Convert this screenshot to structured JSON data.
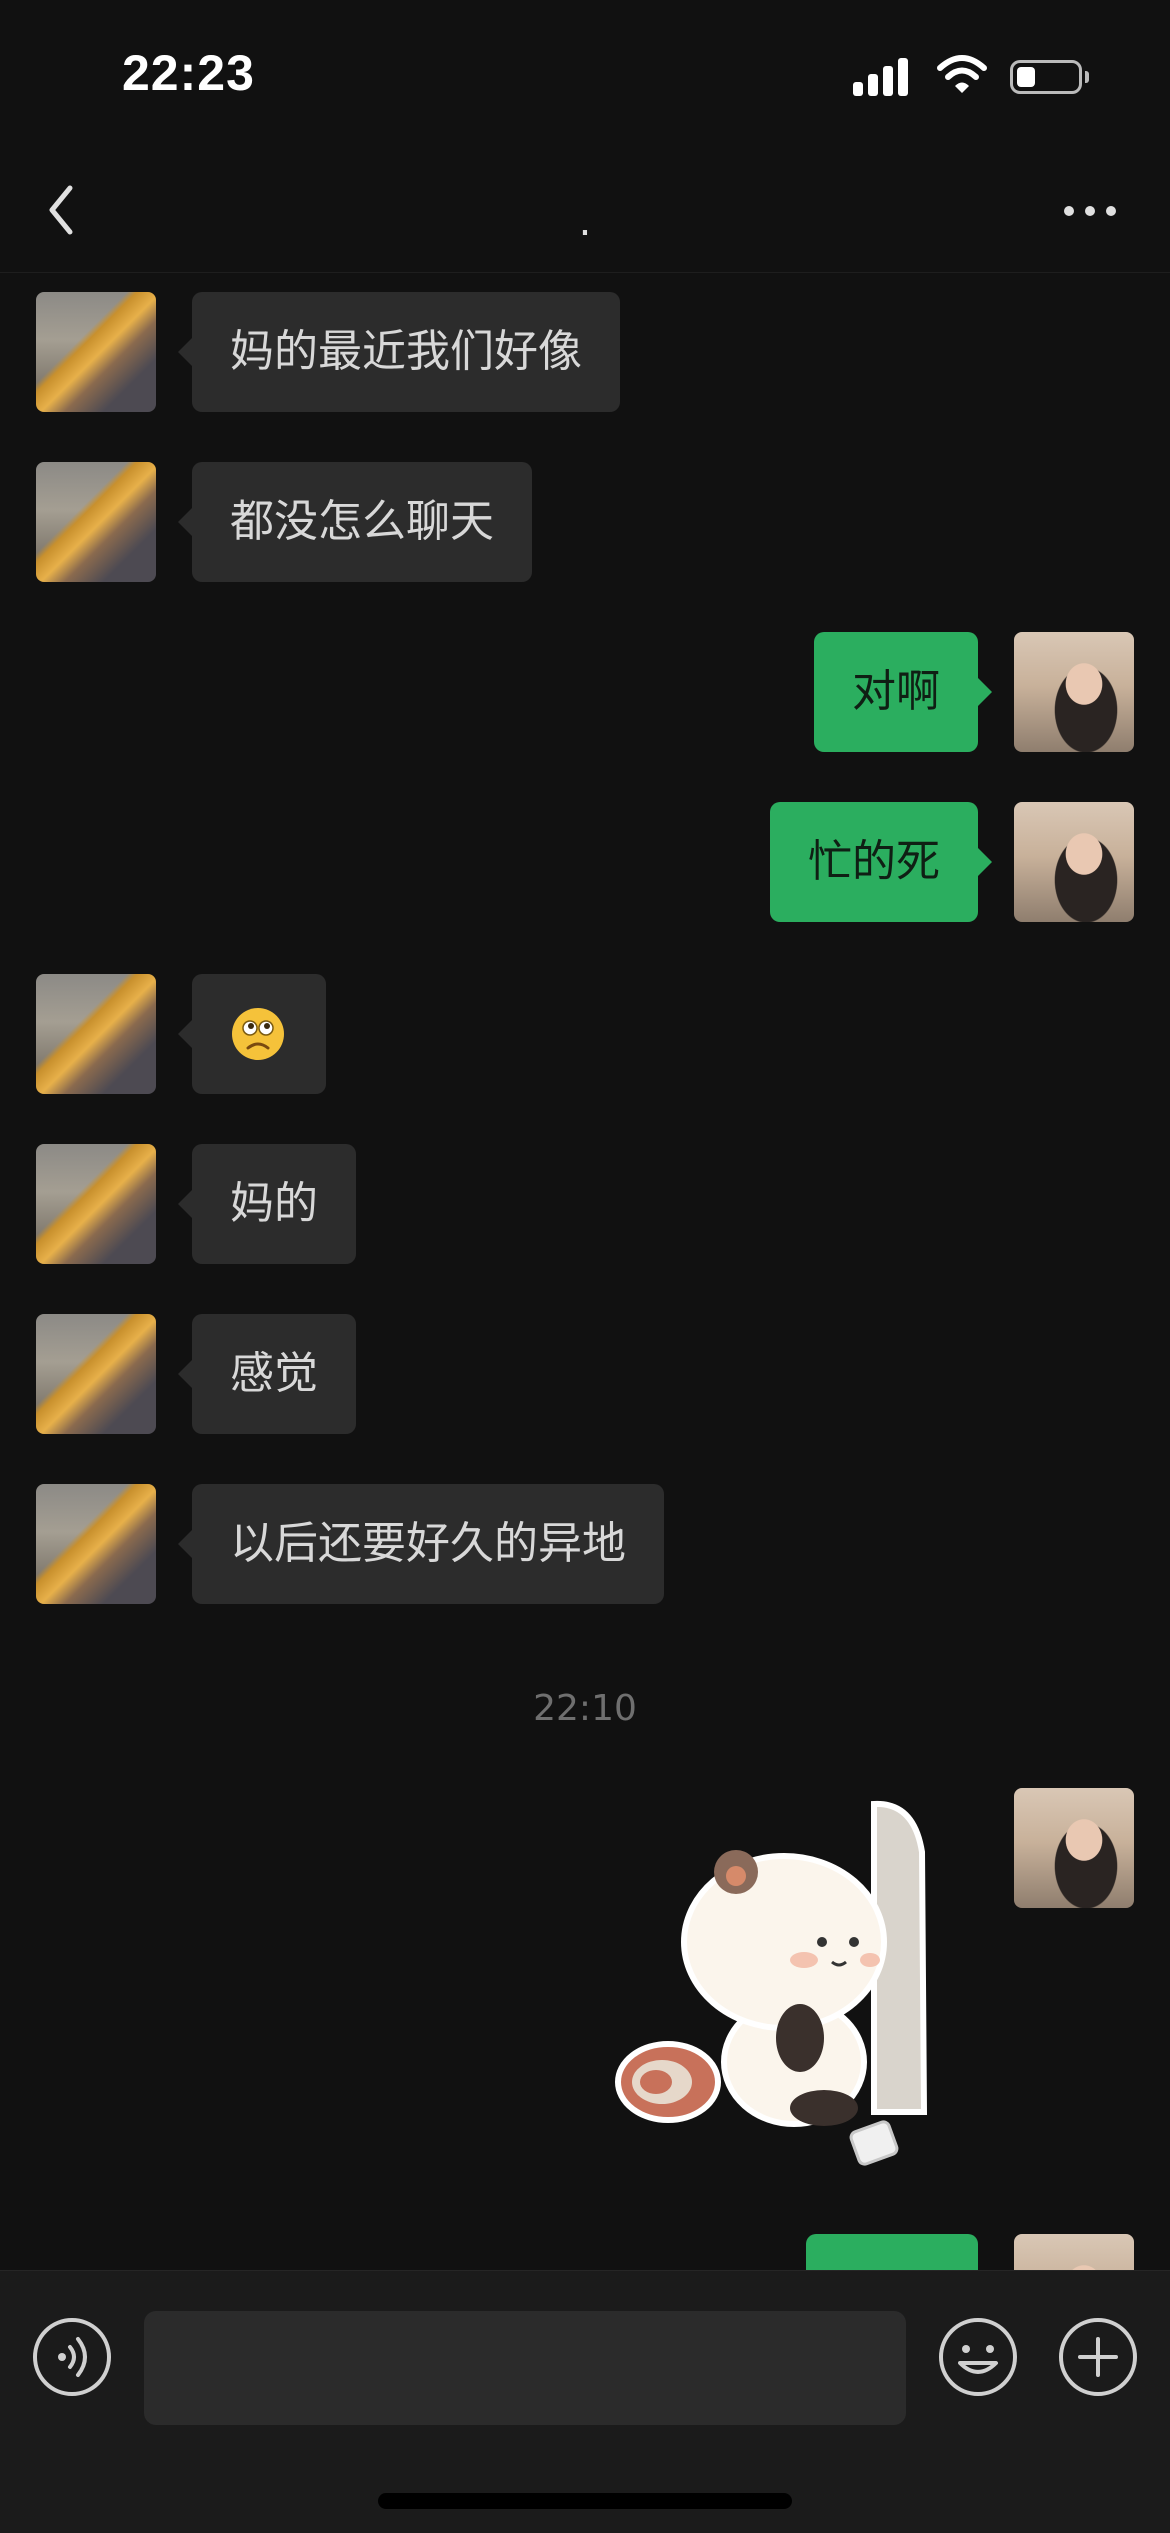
{
  "status_bar": {
    "time": "22:23",
    "battery_level": 0.3
  },
  "nav": {
    "title": "."
  },
  "messages": [
    {
      "side": "in",
      "type": "text",
      "text": "妈的最近我们好像"
    },
    {
      "side": "in",
      "type": "text",
      "text": "都没怎么聊天"
    },
    {
      "side": "out",
      "type": "text",
      "text": "对啊"
    },
    {
      "side": "out",
      "type": "text",
      "text": "忙的死"
    },
    {
      "side": "in",
      "type": "emoji",
      "emoji": "sad-face-icon"
    },
    {
      "side": "in",
      "type": "text",
      "text": "妈的"
    },
    {
      "side": "in",
      "type": "text",
      "text": "感觉"
    },
    {
      "side": "in",
      "type": "text",
      "text": "以后还要好久的异地"
    },
    {
      "type": "timestamp",
      "text": "22:10"
    },
    {
      "side": "out",
      "type": "sticker",
      "sticker": "panda-sticker"
    },
    {
      "side": "out",
      "type": "text",
      "text": ""
    }
  ],
  "colors": {
    "background": "#111111",
    "incoming_bubble": "#2c2c2c",
    "outgoing_bubble": "#2bae5f",
    "input_bar": "#1b1b1b"
  }
}
